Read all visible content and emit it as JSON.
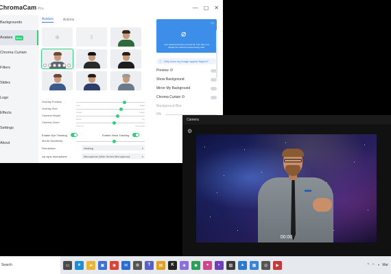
{
  "app": {
    "logo_text": "ChromaCam",
    "edition": "Pro",
    "window_controls": [
      "—",
      "▢",
      "✕"
    ]
  },
  "sidebar": {
    "items": [
      {
        "label": "Backgrounds",
        "active": false
      },
      {
        "label": "Avatars",
        "active": true,
        "badge": "Beta"
      },
      {
        "label": "Chroma Curtain",
        "active": false
      },
      {
        "label": "Filters",
        "active": false
      },
      {
        "label": "Slides",
        "active": false
      },
      {
        "label": "Logo",
        "active": false
      },
      {
        "label": "Effects",
        "active": false
      },
      {
        "label": "Settings",
        "active": false
      },
      {
        "label": "About",
        "active": false
      }
    ]
  },
  "tabs": [
    {
      "label": "Avatars",
      "active": true
    },
    {
      "label": "Actions",
      "active": false
    }
  ],
  "avatars": [
    {
      "kind": "placeholder",
      "icon": "avatar-add-icon"
    },
    {
      "kind": "placeholder",
      "icon": "upload-icon"
    },
    {
      "kind": "person",
      "hair": "#3a2a1c",
      "shirt": "#2f6b3a"
    },
    {
      "kind": "person",
      "hair": "#6b4a2e",
      "shirt": "#5b6570",
      "selected": true
    },
    {
      "kind": "person",
      "hair": "#111111",
      "shirt": "#2a2a2a"
    },
    {
      "kind": "person",
      "hair": "#2a1e14",
      "shirt": "#1e1e1e"
    },
    {
      "kind": "person",
      "hair": "#6b4a2e",
      "shirt": "#3b5a8a"
    },
    {
      "kind": "person",
      "hair": "#2a1e14",
      "shirt": "#2c3f6a"
    },
    {
      "kind": "person",
      "hair": "#999999",
      "shirt": "#6b7a8a"
    }
  ],
  "sliders": [
    {
      "label": "Overlay Position",
      "left": "Left",
      "right": "Right",
      "level": 0.7
    },
    {
      "label": "Overlay Size",
      "left": "Small",
      "right": "Large",
      "level": 0.65
    },
    {
      "label": "Camera Height",
      "left": "Down",
      "right": "Up",
      "level": 0.6
    },
    {
      "label": "Camera Zoom",
      "left": "Zoom In",
      "right": "Zoom Out",
      "level": 0.55
    }
  ],
  "tracking": {
    "eye_label": "Enable Eye Tracking",
    "hand_label": "Enable Hand Tracking",
    "eye_on": true,
    "hand_on": true,
    "mouth_label": "Mouth Sensitivity",
    "mouth_level": 0.55
  },
  "selects": [
    {
      "label": "First Action",
      "value": "Walking"
    },
    {
      "label": "Lip sync microphone",
      "value": "Microphone (Web Series Microphone)"
    }
  ],
  "preview": {
    "message": "Your Camera Preview is turned off. Turn this on to display the camera preview during calls.",
    "info_link": "Why does my image appear flipped?"
  },
  "right_options": [
    {
      "label": "Preview",
      "info": true,
      "dim": false
    },
    {
      "label": "Show Background",
      "info": false,
      "dim": false
    },
    {
      "label": "Mirror My Background",
      "info": false,
      "dim": false
    },
    {
      "label": "Chroma Curtain",
      "info": true,
      "dim": false
    },
    {
      "label": "Background Blur",
      "info": false,
      "dim": true
    }
  ],
  "blur_value": "0%",
  "camera": {
    "title": "Camera",
    "timestamp": "00:00"
  },
  "taskbar": {
    "search_text": "Search",
    "icons": [
      {
        "name": "task-view-icon",
        "color": "#4a4a4a",
        "glyph": "▭"
      },
      {
        "name": "edge-icon",
        "color": "#1e8fd6",
        "glyph": "e"
      },
      {
        "name": "file-explorer-icon",
        "color": "#e8b53a",
        "glyph": "▰"
      },
      {
        "name": "store-icon",
        "color": "#3d6fd8",
        "glyph": "▣"
      },
      {
        "name": "chrome-icon",
        "color": "#d94537",
        "glyph": "◉"
      },
      {
        "name": "mail-icon",
        "color": "#2a6fcf",
        "glyph": "✉"
      },
      {
        "name": "settings-icon",
        "color": "#555555",
        "glyph": "⚙"
      },
      {
        "name": "teams-icon",
        "color": "#5a5fc4",
        "glyph": "T"
      },
      {
        "name": "app-icon",
        "color": "#e0a020",
        "glyph": "▤"
      },
      {
        "name": "k-app-icon",
        "color": "#222222",
        "glyph": "K"
      },
      {
        "name": "photos-icon",
        "color": "#8a6fd8",
        "glyph": "◈"
      },
      {
        "name": "app2-icon",
        "color": "#2aa05a",
        "glyph": "◆"
      },
      {
        "name": "app3-icon",
        "color": "#c94a8a",
        "glyph": "●"
      },
      {
        "name": "app4-icon",
        "color": "#6f3fb8",
        "glyph": "◐"
      },
      {
        "name": "app5-icon",
        "color": "#3a3a3a",
        "glyph": "▨"
      },
      {
        "name": "app6-icon",
        "color": "#2a7ad0",
        "glyph": "▲"
      },
      {
        "name": "app7-icon",
        "color": "#3a82d8",
        "glyph": "▦"
      },
      {
        "name": "camera-app-icon",
        "color": "#555555",
        "glyph": "◎"
      },
      {
        "name": "app8-icon",
        "color": "#c03a3a",
        "glyph": "▶"
      }
    ],
    "tray_date": "Mar"
  }
}
